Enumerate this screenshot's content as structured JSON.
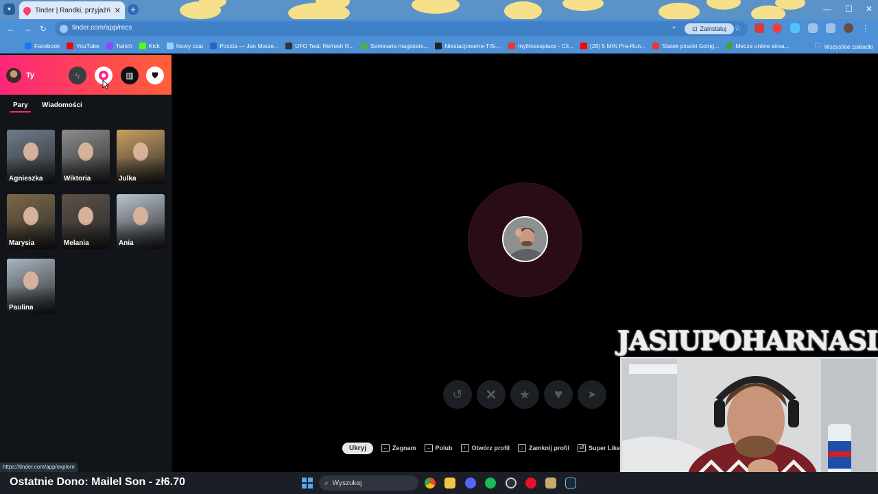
{
  "browser": {
    "tab_title": "Tinder | Randki, przyjaźń, nowe",
    "url": "tinder.com/app/recs",
    "install_label": "Zainstaluj",
    "bookmarks": [
      {
        "label": "Facebook",
        "color": "#1877f2"
      },
      {
        "label": "YouTube",
        "color": "#ff0000"
      },
      {
        "label": "Twitch",
        "color": "#9146ff"
      },
      {
        "label": "Kick",
        "color": "#53fc18"
      },
      {
        "label": "Nowy czat",
        "color": "#9bd0ff"
      },
      {
        "label": "Poczta — Jan Marze...",
        "color": "#2a64c5"
      },
      {
        "label": "UFO Test: Refresh R...",
        "color": "#333333"
      },
      {
        "label": "Seminaria magisters...",
        "color": "#4caf50"
      },
      {
        "label": "Niestacjonarne-TIS-...",
        "color": "#222222"
      },
      {
        "label": "myfitnessplace - Cli...",
        "color": "#e53935"
      },
      {
        "label": "(28) 5 MIN Pre-Run...",
        "color": "#ff0000"
      },
      {
        "label": "Statek piracki Going...",
        "color": "#e53935"
      },
      {
        "label": "Mecze online strea...",
        "color": "#43a047"
      }
    ],
    "all_bookmarks": "Wszystkie zakładki",
    "status_url": "https://tinder.com/app/explore"
  },
  "sidebar": {
    "user_name": "Ty",
    "tabs": {
      "matches": "Pary",
      "messages": "Wiadomości"
    },
    "matches": [
      {
        "name": "Agnieszka",
        "tone": "#6f7d8c"
      },
      {
        "name": "Wiktoria",
        "tone": "#8d8d8d"
      },
      {
        "name": "Julka",
        "tone": "#c9a060"
      },
      {
        "name": "Marysia",
        "tone": "#7c6a48"
      },
      {
        "name": "Melania",
        "tone": "#5e5148"
      },
      {
        "name": "Ania",
        "tone": "#b9c4cc"
      },
      {
        "name": "Paulina",
        "tone": "#a8b6c2"
      }
    ]
  },
  "actions": {
    "hide_label": "Ukryj",
    "shortcuts": [
      {
        "key": "←",
        "label": "Żegnam"
      },
      {
        "key": "→",
        "label": "Polub"
      },
      {
        "key": "↑",
        "label": "Otwórz profil"
      },
      {
        "key": "↓",
        "label": "Zamknij profil"
      },
      {
        "key": "⏎",
        "label": "Super Like"
      }
    ]
  },
  "taskbar": {
    "donation": "Ostatnie Dono: Mailel Son - zł6.70",
    "search_placeholder": "Wyszukaj"
  },
  "overlay": {
    "cam_title": "JASIUPOHARNASIU"
  },
  "colors": {
    "accent": "#fd267a",
    "accent2": "#ff6036"
  }
}
